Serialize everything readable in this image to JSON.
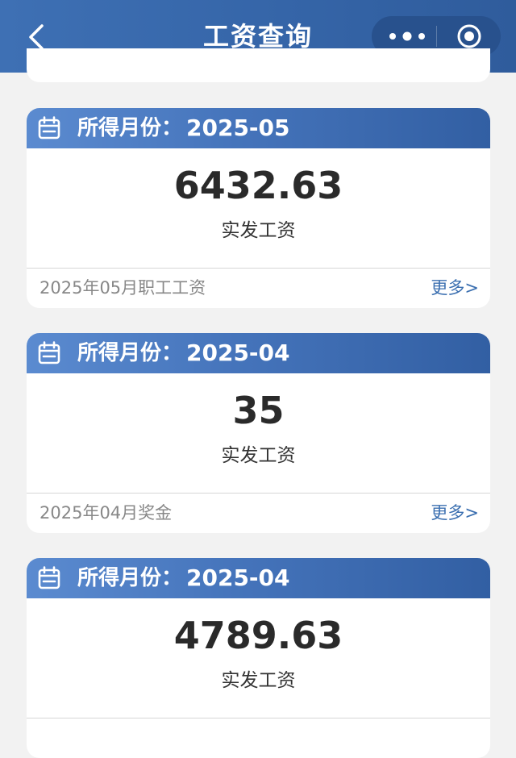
{
  "nav": {
    "title": "工资查询"
  },
  "cards": [
    {
      "label": "所得月份：",
      "month": "2025-05",
      "amount": "6432.63",
      "amount_label": "实发工资",
      "footer": "2025年05月职工工资",
      "more": "更多>"
    },
    {
      "label": "所得月份：",
      "month": "2025-04",
      "amount": "35",
      "amount_label": "实发工资",
      "footer": "2025年04月奖金",
      "more": "更多>"
    },
    {
      "label": "所得月份：",
      "month": "2025-04",
      "amount": "4789.63",
      "amount_label": "实发工资"
    }
  ],
  "colors": {
    "nav": "#3565a8",
    "header_start": "#5b8bd0",
    "header_end": "#325fa3",
    "link": "#3b6fb0",
    "background": "#f2f2f2"
  },
  "icons": [
    "back-arrow-icon",
    "more-dots-icon",
    "target-icon",
    "calendar-icon"
  ]
}
